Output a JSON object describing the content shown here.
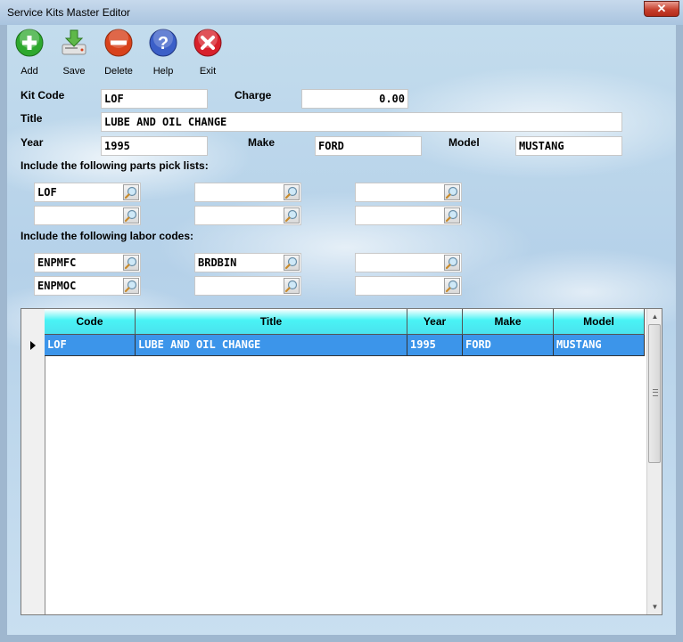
{
  "window": {
    "title": "Service Kits Master Editor",
    "close_glyph": "✕"
  },
  "toolbar": [
    {
      "label": "Add",
      "icon": "add-icon",
      "color": "#2ea82e"
    },
    {
      "label": "Save",
      "icon": "save-icon",
      "color": "#5fb84a"
    },
    {
      "label": "Delete",
      "icon": "delete-icon",
      "color": "#d8421c"
    },
    {
      "label": "Help",
      "icon": "help-icon",
      "color": "#3b5fc8"
    },
    {
      "label": "Exit",
      "icon": "exit-icon",
      "color": "#d8202b"
    }
  ],
  "form": {
    "kit_code_label": "Kit Code",
    "kit_code": "LOF",
    "charge_label": "Charge",
    "charge": "0.00",
    "title_label": "Title",
    "title": "LUBE AND OIL CHANGE",
    "year_label": "Year",
    "year": "1995",
    "make_label": "Make",
    "make": "FORD",
    "model_label": "Model",
    "model": "MUSTANG"
  },
  "parts": {
    "label": "Include the following parts pick lists:",
    "values": [
      "LOF",
      "",
      "",
      "",
      "",
      ""
    ]
  },
  "labor": {
    "label": "Include the following labor codes:",
    "values": [
      "ENPMFC",
      "BRDBIN",
      "",
      "ENPMOC",
      "",
      ""
    ]
  },
  "grid": {
    "columns": [
      "Code",
      "Title",
      "Year",
      "Make",
      "Model"
    ],
    "rows": [
      {
        "code": "LOF",
        "title": "LUBE AND OIL CHANGE",
        "year": "1995",
        "make": "FORD",
        "model": "MUSTANG"
      }
    ],
    "selected_color": "#3c95ea",
    "header_color": "#49f3f5"
  }
}
